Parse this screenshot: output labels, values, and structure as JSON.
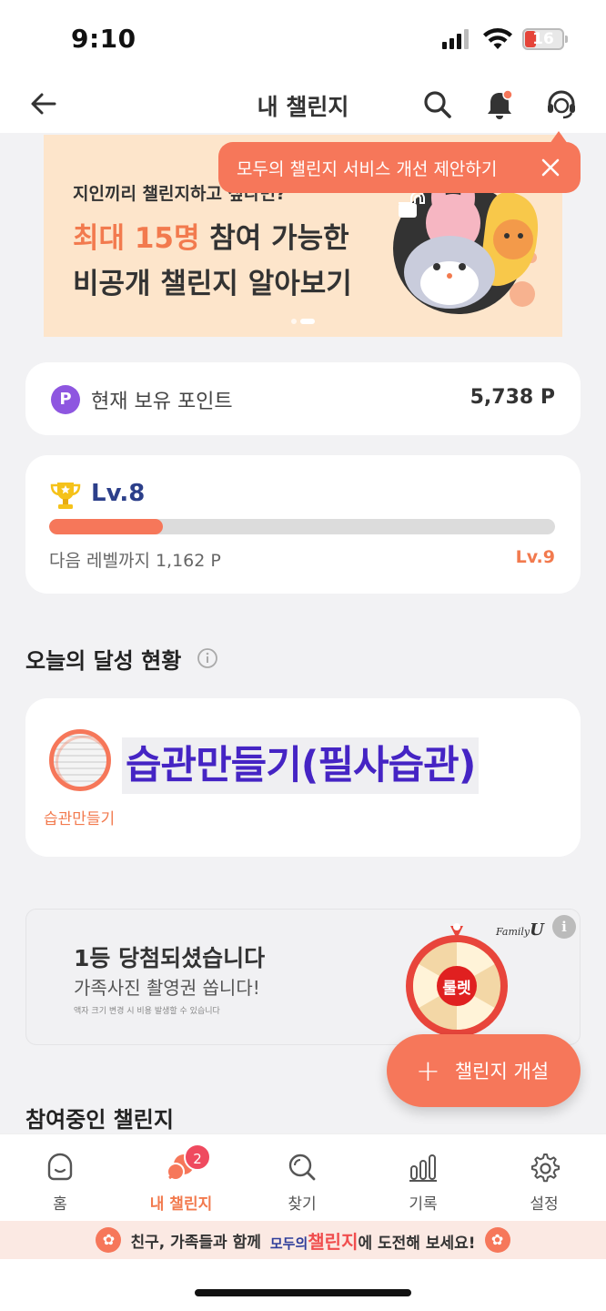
{
  "status_bar": {
    "time": "9:10",
    "battery": "16"
  },
  "header": {
    "title": "내 챌린지"
  },
  "tooltip": {
    "text": "모두의 챌린지 서비스 개선 제안하기"
  },
  "banner": {
    "subtitle": "지인끼리 챌린지하고 싶다면?",
    "line1_highlight": "최대 15명",
    "line1_rest": " 참여 가능한",
    "line2": "비공개 챌린지 알아보기"
  },
  "points": {
    "icon_letter": "P",
    "label": "현재 보유 포인트",
    "value": "5,738 P"
  },
  "level": {
    "current": "Lv.8",
    "progress_fraction": 0.225,
    "next_label": "다음 레벨까지",
    "remaining": "1,162 P",
    "next_level": "Lv.9"
  },
  "today": {
    "section_title": "오늘의 달성 현황",
    "challenge_title": "습관만들기(필사습관)",
    "challenge_caption": "습관만들기"
  },
  "ad": {
    "headline": "1등 당첨되셨습니다",
    "subline": "가족사진 촬영권 쏩니다!",
    "note": "액자 크기 변경 시 비용 발생할 수 있습니다",
    "brand_small": "Family",
    "brand_big": "U",
    "info": "i",
    "wheel_label": "룰렛"
  },
  "fab": {
    "plus": "+",
    "label": "챌린지 개설"
  },
  "participating": {
    "section_title": "참여중인 챌린지"
  },
  "tabbar": {
    "tabs": [
      {
        "label": "홈",
        "icon": "home-icon"
      },
      {
        "label": "내 챌린지",
        "icon": "my-challenge-icon"
      },
      {
        "label": "찾기",
        "icon": "search-icon"
      },
      {
        "label": "기록",
        "icon": "chart-icon"
      },
      {
        "label": "설정",
        "icon": "gear-icon"
      }
    ],
    "badge": "2",
    "active_index": 1
  },
  "footer_banner": {
    "prefix": "친구, 가족들과 함께",
    "brand_a": "모두의",
    "brand_b": "챌린지",
    "suffix": "에 도전해 보세요!"
  },
  "colors": {
    "accent": "#f6775a",
    "level_text": "#2c3f8a",
    "title_purple": "#4524c4"
  }
}
